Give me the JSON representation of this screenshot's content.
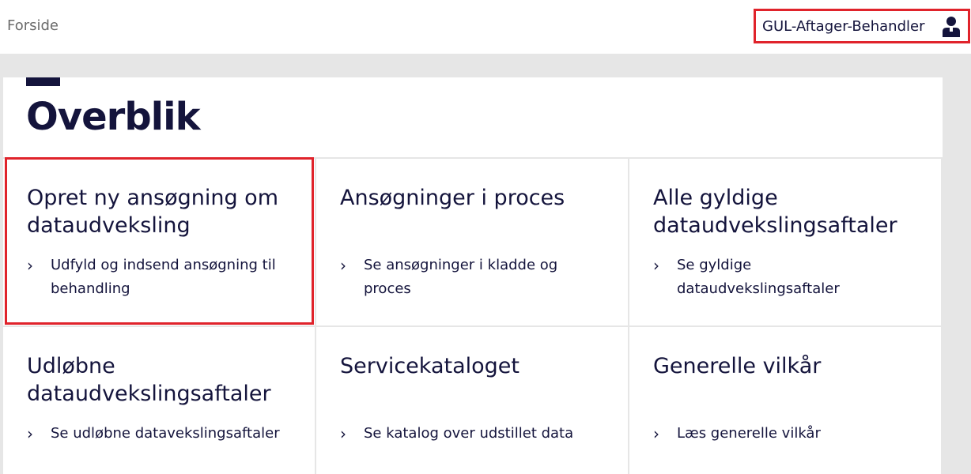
{
  "header": {
    "breadcrumb": "Forside",
    "user_name": "GUL-Aftager-Behandler",
    "user_icon": "user-icon"
  },
  "main": {
    "title": "Overblik",
    "cards": [
      {
        "title": "Opret ny ansøgning om dataudveksling",
        "link": "Udfyld og indsend ansøgning til behandling"
      },
      {
        "title": "Ansøgninger i proces",
        "link": "Se ansøgninger i kladde og proces"
      },
      {
        "title": "Alle gyldige dataudvekslingsaftaler",
        "link": "Se gyldige dataudvekslingsaftaler"
      },
      {
        "title": "Udløbne dataudvekslingsaftaler",
        "link": "Se udløbne datavekslingsaftaler"
      },
      {
        "title": "Servicekataloget",
        "link": "Se katalog over udstillet data"
      },
      {
        "title": "Generelle vilkår",
        "link": "Læs generelle vilkår"
      }
    ]
  },
  "colors": {
    "text": "#14143c",
    "highlight": "#e0232b",
    "backdrop": "#e6e6e6"
  },
  "icons": {
    "chevron": "chevron-right-icon"
  }
}
